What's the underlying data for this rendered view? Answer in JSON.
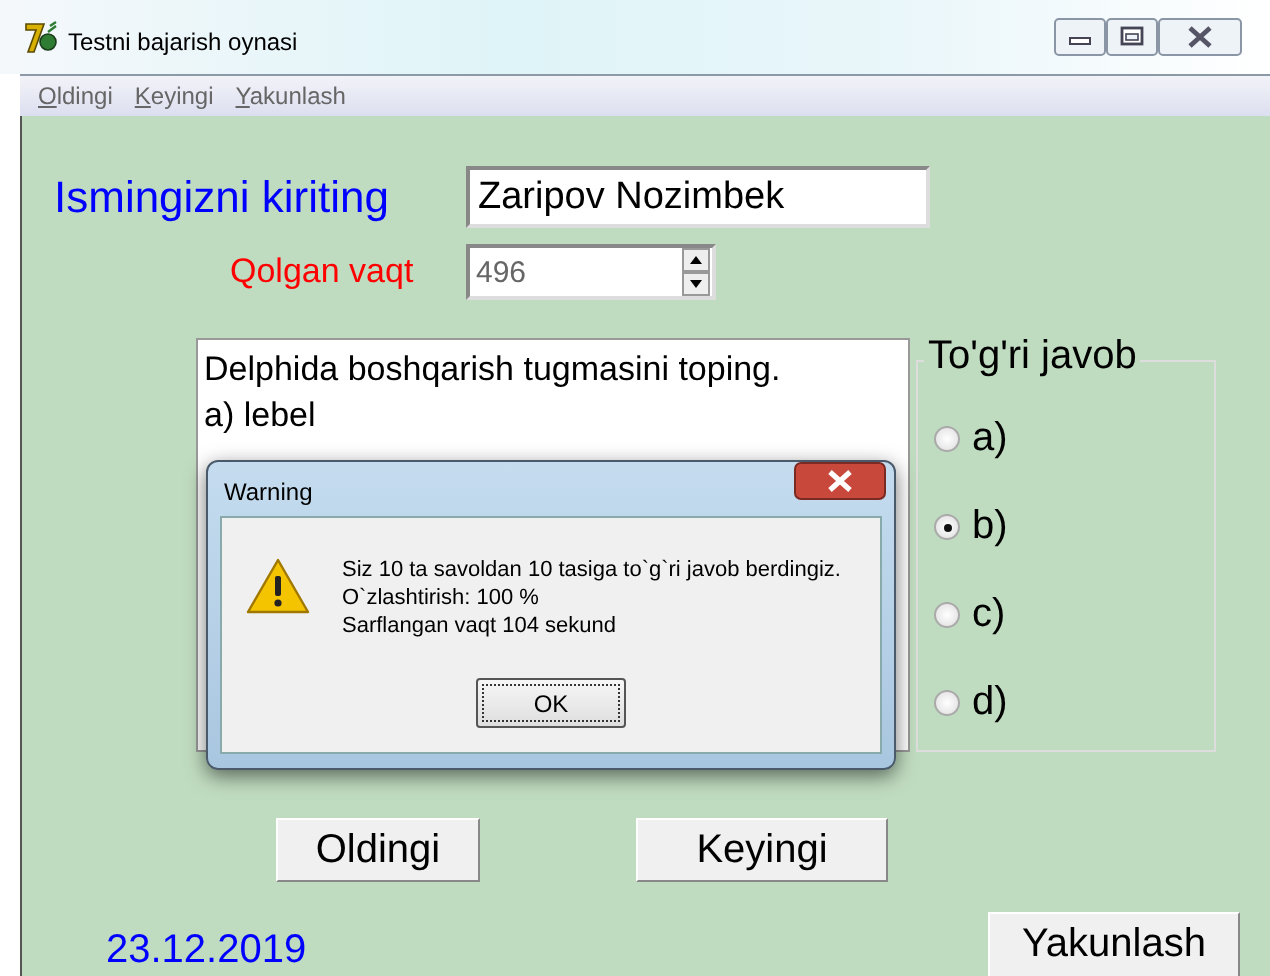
{
  "window": {
    "title": "Testni bajarish oynasi"
  },
  "menu": [
    "Oldingi",
    "Keyingi",
    "Yakunlash"
  ],
  "name_label": "Ismingizni kiriting",
  "name_value": "Zaripov Nozimbek",
  "time_label": "Qolgan vaqt",
  "time_value": "496",
  "question_lines": [
    "Delphida boshqarish tugmasini toping.",
    "a) lebel"
  ],
  "answers": {
    "title": "To'g'ri javob",
    "options": [
      {
        "label": "a)",
        "selected": false
      },
      {
        "label": "b)",
        "selected": true
      },
      {
        "label": "c)",
        "selected": false
      },
      {
        "label": "d)",
        "selected": false
      }
    ]
  },
  "buttons": [
    "Oldingi",
    "Keyingi"
  ],
  "date": "23.12.2019",
  "finish_button": "Yakunlash",
  "dialog": {
    "title": "Warning",
    "lines": [
      "Siz 10 ta savoldan 10 tasiga to`g`ri javob berdingiz.",
      "O`zlashtirish: 100 %",
      "Sarflangan vaqt  104 sekund"
    ],
    "button": "OK"
  }
}
